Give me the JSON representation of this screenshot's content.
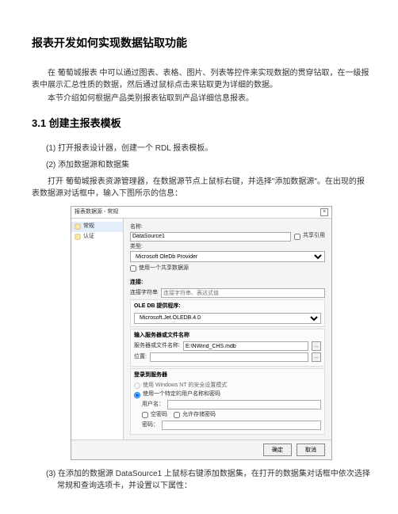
{
  "title": "报表开发如何实现数据钻取功能",
  "para1": "在 葡萄城报表 中可以通过图表、表格、图片、列表等控件来实现数据的贯穿钻取，在一级报表中展示汇总性质的数据，然后通过鼠标点击来钻取更为详细的数据。",
  "para2": "本节介绍如何根据产品类别报表钻取到产品详细信息报表。",
  "section_heading": "3.1 创建主报表模板",
  "steps": {
    "s1": "(1) 打开报表设计器，创建一个 RDL 报表模板。",
    "s2": "(2) 添加数据源和数据集",
    "s2a": "打开 葡萄城报表资源管理器，在数据源节点上鼠标右键，并选择\"添加数据源\"。在出现的报表数据源对话框中，输入下图所示的信息：",
    "s3": "(3) 在添加的数据源 DataSource1 上鼠标右键添加数据集，在打开的数据集对话框中依次选择常规和查询选项卡，并设置以下属性："
  },
  "dialog": {
    "title": "报表数据源 - 常规",
    "close": "×",
    "sidebar": {
      "general": "常规",
      "credentials": "认证"
    },
    "name_label": "名称:",
    "name_value": "DataSource1",
    "shared_ref": "共享引用",
    "type_label": "类型:",
    "type_value": "Microsoft OleDb Provider",
    "use_shared_ds": "使用一个共享数据源",
    "conn_header": "连接:",
    "conn_string_label": "连接字符串",
    "conn_string_placeholder": "连接字符串、表达式值",
    "oledb_header": "OLE DB 提供程序:",
    "oledb_value": "Microsoft.Jet.OLEDB.4.0",
    "server_header": "输入服务器或文件名称",
    "server_file_label": "服务器或文件名称:",
    "server_file_value": "E:\\NWind_CHS.mdb",
    "location": "位置:",
    "login_header": "登录到服务器",
    "winnt_radio": "使用 Windows NT 的安全设置模式",
    "custom_login_radio": "使用一个特定的用户名称和密码",
    "user_label": "用户名：",
    "empty_pw": "空密码",
    "allow_save_pw": "允许存储密码",
    "pw_label": "密码：",
    "sq_btn": "…",
    "ok": "确定",
    "cancel": "取消"
  }
}
